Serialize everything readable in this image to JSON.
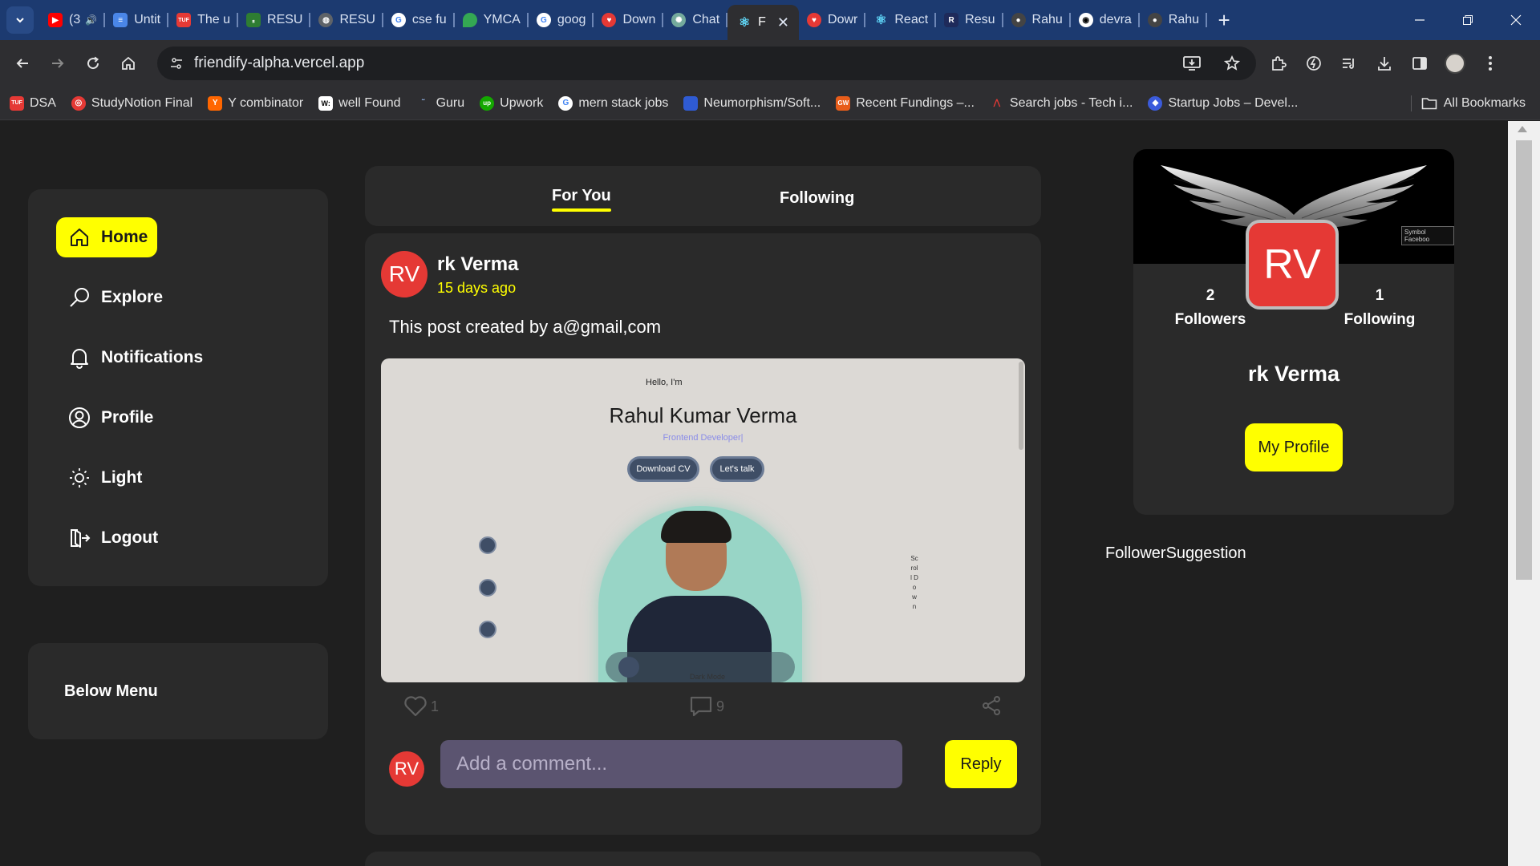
{
  "browser": {
    "tabs": [
      {
        "title": "(3",
        "favicon": "youtube-icon",
        "color": "#ff0000"
      },
      {
        "title": "Untit",
        "favicon": "docs-icon",
        "color": "#4a86e8"
      },
      {
        "title": "The u",
        "favicon": "tuf-icon",
        "color": "#e53935"
      },
      {
        "title": "RESU",
        "favicon": "resume-icon",
        "color": "#2e7d32"
      },
      {
        "title": "RESU",
        "favicon": "globe-icon",
        "color": "#5f6368"
      },
      {
        "title": "cse fu",
        "favicon": "google-icon",
        "color": "#ffffff"
      },
      {
        "title": "YMCA",
        "favicon": "maps-icon",
        "color": "#34a853"
      },
      {
        "title": "goog",
        "favicon": "google-icon",
        "color": "#ffffff"
      },
      {
        "title": "Down",
        "favicon": "heart-icon",
        "color": "#e53935"
      },
      {
        "title": "Chat",
        "favicon": "chatgpt-icon",
        "color": "#74aa9c"
      },
      {
        "title": "F",
        "favicon": "react-icon",
        "color": "#61dafb",
        "active": true
      },
      {
        "title": "Dowr",
        "favicon": "heart-icon",
        "color": "#e53935"
      },
      {
        "title": "React",
        "favicon": "react-icon",
        "color": "#61dafb"
      },
      {
        "title": "Resu",
        "favicon": "r-icon",
        "color": "#1e2a5a"
      },
      {
        "title": "Rahu",
        "favicon": "person-icon",
        "color": "#444444"
      },
      {
        "title": "devra",
        "favicon": "github-icon",
        "color": "#ffffff"
      },
      {
        "title": "Rahu",
        "favicon": "person-icon",
        "color": "#444444"
      }
    ],
    "url": "friendify-alpha.vercel.app",
    "bookmarks": [
      {
        "label": "DSA",
        "favicon": "tuf-icon",
        "color": "#e53935"
      },
      {
        "label": "StudyNotion Final",
        "favicon": "studynotion-icon",
        "color": "#e53935"
      },
      {
        "label": "Y combinator",
        "favicon": "ycombinator-icon",
        "color": "#ff6600"
      },
      {
        "label": "well Found",
        "favicon": "wellfound-icon",
        "color": "#ffffff"
      },
      {
        "label": "Guru",
        "favicon": "guru-icon",
        "color": "#2e2e31"
      },
      {
        "label": "Upwork",
        "favicon": "upwork-icon",
        "color": "#14a800"
      },
      {
        "label": "mern stack jobs",
        "favicon": "google-icon",
        "color": "#ffffff"
      },
      {
        "label": "Neumorphism/Soft...",
        "favicon": "square-icon",
        "color": "#2f5bd3"
      },
      {
        "label": "Recent Fundings –...",
        "favicon": "gw-icon",
        "color": "#e85d1a"
      },
      {
        "label": "Search jobs - Tech i...",
        "favicon": "tech-icon",
        "color": "#c62828"
      },
      {
        "label": "Startup Jobs – Devel...",
        "favicon": "startup-icon",
        "color": "#3b5bdb"
      }
    ],
    "all_bookmarks": "All Bookmarks"
  },
  "sidebar": {
    "items": [
      {
        "label": "Home",
        "icon": "home-icon",
        "active": true
      },
      {
        "label": "Explore",
        "icon": "search-icon"
      },
      {
        "label": "Notifications",
        "icon": "bell-icon"
      },
      {
        "label": "Profile",
        "icon": "user-circle-icon"
      },
      {
        "label": "Light",
        "icon": "sun-icon"
      },
      {
        "label": "Logout",
        "icon": "logout-icon"
      }
    ],
    "below_menu": "Below Menu"
  },
  "feed": {
    "tabs": [
      {
        "label": "For You",
        "active": true
      },
      {
        "label": "Following"
      }
    ]
  },
  "post": {
    "avatar": "RV",
    "author": "rk Verma",
    "time": "15 days ago",
    "text": "This post created by a@gmail,com",
    "image": {
      "hello": "Hello, I'm",
      "name": "Rahul Kumar Verma",
      "role": "Frontend Developer|",
      "btn_cv": "Download CV",
      "btn_talk": "Let's talk",
      "scroll": "Scroll Down",
      "dark_mode": "Dark Mode"
    },
    "likes": "1",
    "comments": "9",
    "comment_avatar": "RV",
    "comment_placeholder": "Add a comment...",
    "reply": "Reply"
  },
  "profile_card": {
    "cover_label": "Symbol Faceboo",
    "avatar": "RV",
    "followers_count": "2",
    "followers_label": "Followers",
    "following_count": "1",
    "following_label": "Following",
    "name": "rk Verma",
    "button": "My Profile"
  },
  "suggestion_label": "FollowerSuggestion",
  "colors": {
    "accent": "#ffff00",
    "avatar": "#e53935",
    "card": "#2a2a2a",
    "background": "#1f1f1f"
  }
}
